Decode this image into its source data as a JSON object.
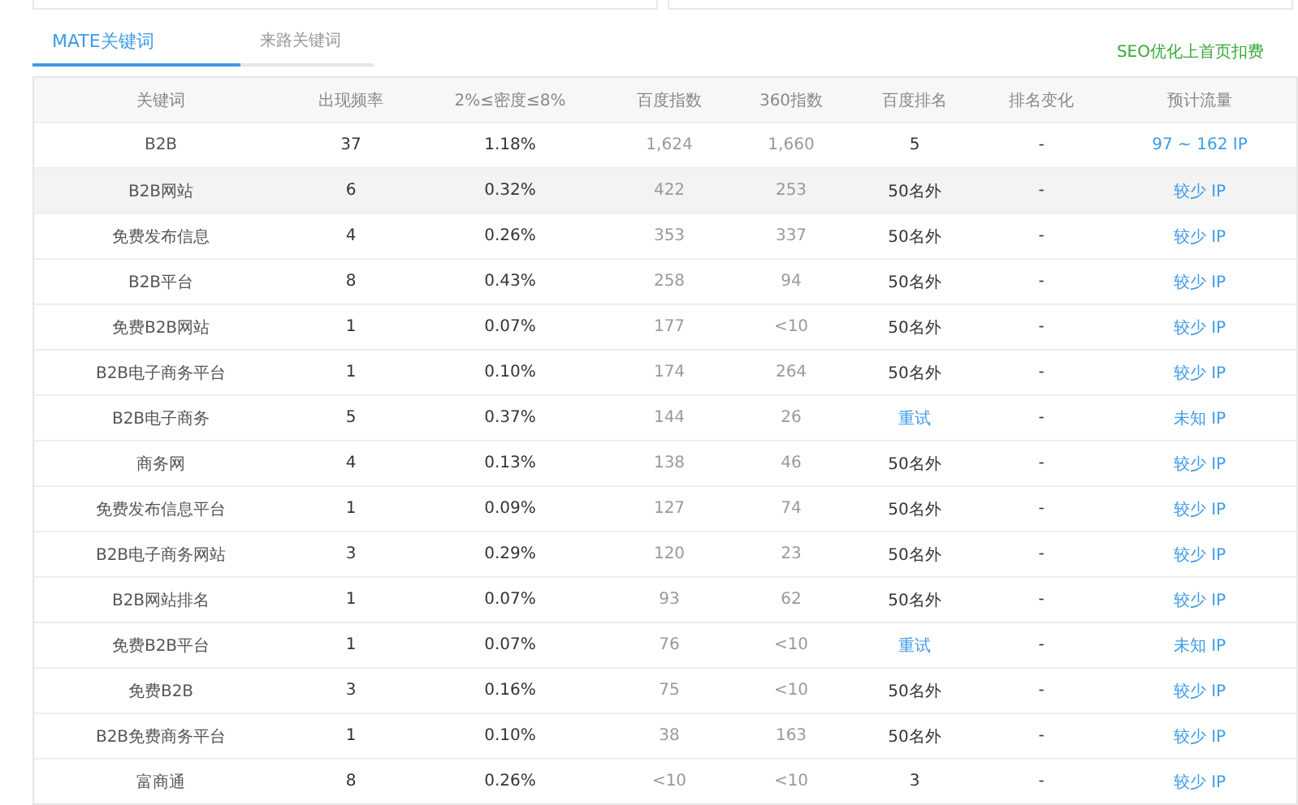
{
  "tabs": [
    {
      "label": "MATE关键词",
      "selected": true
    },
    {
      "label": "来路关键词",
      "selected": false
    }
  ],
  "promo_link": "SEO优化上首页扣费",
  "table": {
    "columns": [
      "关键词",
      "出现频率",
      "2%≤密度≤8%",
      "百度指数",
      "360指数",
      "百度排名",
      "排名变化",
      "预计流量"
    ],
    "rows": [
      {
        "keyword": "B2B",
        "frequency": "37",
        "density": "1.18%",
        "baidu_index": "1,624",
        "index_360": "1,660",
        "rank": {
          "kind": "text",
          "text": "5"
        },
        "change": "-",
        "traffic": "97 ~ 162 IP",
        "selected": false
      },
      {
        "keyword": "B2B网站",
        "frequency": "6",
        "density": "0.32%",
        "baidu_index": "422",
        "index_360": "253",
        "rank": {
          "kind": "text",
          "text": "50名外"
        },
        "change": "-",
        "traffic": "较少 IP",
        "selected": true
      },
      {
        "keyword": "免费发布信息",
        "frequency": "4",
        "density": "0.26%",
        "baidu_index": "353",
        "index_360": "337",
        "rank": {
          "kind": "text",
          "text": "50名外"
        },
        "change": "-",
        "traffic": "较少 IP",
        "selected": false
      },
      {
        "keyword": "B2B平台",
        "frequency": "8",
        "density": "0.43%",
        "baidu_index": "258",
        "index_360": "94",
        "rank": {
          "kind": "text",
          "text": "50名外"
        },
        "change": "-",
        "traffic": "较少 IP",
        "selected": false
      },
      {
        "keyword": "免费B2B网站",
        "frequency": "1",
        "density": "0.07%",
        "baidu_index": "177",
        "index_360": "<10",
        "rank": {
          "kind": "text",
          "text": "50名外"
        },
        "change": "-",
        "traffic": "较少 IP",
        "selected": false
      },
      {
        "keyword": "B2B电子商务平台",
        "frequency": "1",
        "density": "0.10%",
        "baidu_index": "174",
        "index_360": "264",
        "rank": {
          "kind": "text",
          "text": "50名外"
        },
        "change": "-",
        "traffic": "较少 IP",
        "selected": false
      },
      {
        "keyword": "B2B电子商务",
        "frequency": "5",
        "density": "0.37%",
        "baidu_index": "144",
        "index_360": "26",
        "rank": {
          "kind": "link",
          "text": "重试"
        },
        "change": "-",
        "traffic": "未知 IP",
        "selected": false
      },
      {
        "keyword": "商务网",
        "frequency": "4",
        "density": "0.13%",
        "baidu_index": "138",
        "index_360": "46",
        "rank": {
          "kind": "text",
          "text": "50名外"
        },
        "change": "-",
        "traffic": "较少 IP",
        "selected": false
      },
      {
        "keyword": "免费发布信息平台",
        "frequency": "1",
        "density": "0.09%",
        "baidu_index": "127",
        "index_360": "74",
        "rank": {
          "kind": "text",
          "text": "50名外"
        },
        "change": "-",
        "traffic": "较少 IP",
        "selected": false
      },
      {
        "keyword": "B2B电子商务网站",
        "frequency": "3",
        "density": "0.29%",
        "baidu_index": "120",
        "index_360": "23",
        "rank": {
          "kind": "text",
          "text": "50名外"
        },
        "change": "-",
        "traffic": "较少 IP",
        "selected": false
      },
      {
        "keyword": "B2B网站排名",
        "frequency": "1",
        "density": "0.07%",
        "baidu_index": "93",
        "index_360": "62",
        "rank": {
          "kind": "text",
          "text": "50名外"
        },
        "change": "-",
        "traffic": "较少 IP",
        "selected": false
      },
      {
        "keyword": "免费B2B平台",
        "frequency": "1",
        "density": "0.07%",
        "baidu_index": "76",
        "index_360": "<10",
        "rank": {
          "kind": "link",
          "text": "重试"
        },
        "change": "-",
        "traffic": "未知 IP",
        "selected": false
      },
      {
        "keyword": "免费B2B",
        "frequency": "3",
        "density": "0.16%",
        "baidu_index": "75",
        "index_360": "<10",
        "rank": {
          "kind": "text",
          "text": "50名外"
        },
        "change": "-",
        "traffic": "较少 IP",
        "selected": false
      },
      {
        "keyword": "B2B免费商务平台",
        "frequency": "1",
        "density": "0.10%",
        "baidu_index": "38",
        "index_360": "163",
        "rank": {
          "kind": "text",
          "text": "50名外"
        },
        "change": "-",
        "traffic": "较少 IP",
        "selected": false
      },
      {
        "keyword": "富商通",
        "frequency": "8",
        "density": "0.26%",
        "baidu_index": "<10",
        "index_360": "<10",
        "rank": {
          "kind": "text",
          "text": "3"
        },
        "change": "-",
        "traffic": "较少 IP",
        "selected": false
      }
    ]
  }
}
